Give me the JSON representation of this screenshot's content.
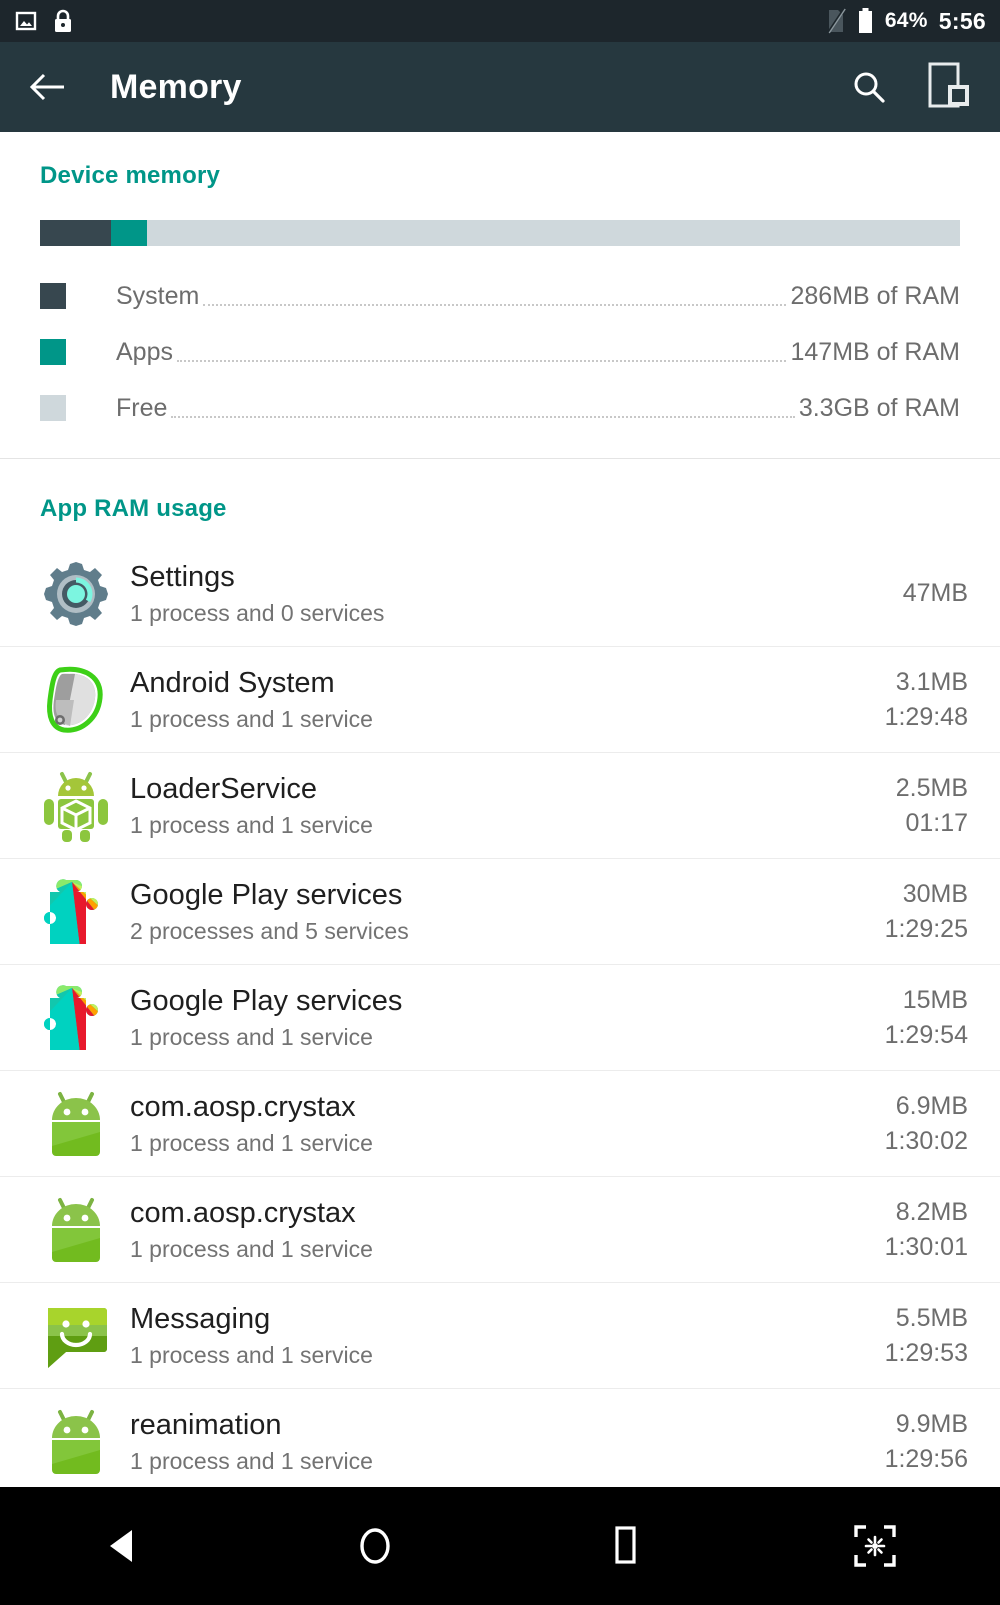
{
  "statusbar": {
    "left_icons": [
      "image-icon",
      "lock-icon"
    ],
    "right_icons": [
      "no-sim-icon",
      "battery-icon"
    ],
    "battery": "64%",
    "clock": "5:56"
  },
  "toolbar": {
    "back_icon": "arrow-back-icon",
    "title": "Memory",
    "search_icon": "search-icon",
    "device_icon": "device-chip-icon"
  },
  "device_memory": {
    "heading": "Device memory",
    "bar": [
      {
        "name": "System",
        "percent": 7.7,
        "color": "#37474f"
      },
      {
        "name": "Apps",
        "percent": 3.9,
        "color": "#009688"
      },
      {
        "name": "Free",
        "percent": 88.4,
        "color": "#cfd8dc"
      }
    ],
    "legend": [
      {
        "label": "System",
        "value": "286MB of RAM",
        "color": "#37474f"
      },
      {
        "label": "Apps",
        "value": "147MB of RAM",
        "color": "#009688"
      },
      {
        "label": "Free",
        "value": "3.3GB of RAM",
        "color": "#cfd8dc"
      }
    ]
  },
  "app_ram_usage": {
    "heading": "App RAM usage",
    "rows": [
      {
        "icon": "settings-gear-icon",
        "name": "Settings",
        "sub": "1 process and 0 services",
        "mem": "47MB",
        "time": ""
      },
      {
        "icon": "android-system-icon",
        "name": "Android System",
        "sub": "1 process and 1 service",
        "mem": "3.1MB",
        "time": "1:29:48"
      },
      {
        "icon": "android-box-robot-icon",
        "name": "LoaderService",
        "sub": "1 process and 1 service",
        "mem": "2.5MB",
        "time": "01:17"
      },
      {
        "icon": "google-play-services-icon",
        "name": "Google Play services",
        "sub": "2 processes and 5 services",
        "mem": "30MB",
        "time": "1:29:25"
      },
      {
        "icon": "google-play-services-icon",
        "name": "Google Play services",
        "sub": "1 process and 1 service",
        "mem": "15MB",
        "time": "1:29:54"
      },
      {
        "icon": "android-default-icon",
        "name": "com.aosp.crystax",
        "sub": "1 process and 1 service",
        "mem": "6.9MB",
        "time": "1:30:02"
      },
      {
        "icon": "android-default-icon",
        "name": "com.aosp.crystax",
        "sub": "1 process and 1 service",
        "mem": "8.2MB",
        "time": "1:30:01"
      },
      {
        "icon": "messaging-icon",
        "name": "Messaging",
        "sub": "1 process and 1 service",
        "mem": "5.5MB",
        "time": "1:29:53"
      },
      {
        "icon": "android-default-icon",
        "name": "reanimation",
        "sub": "1 process and 1 service",
        "mem": "9.9MB",
        "time": "1:29:56"
      }
    ]
  },
  "navbar": {
    "back": "nav-back-icon",
    "home": "nav-home-icon",
    "recents": "nav-recents-icon",
    "screenshot": "nav-screenshot-icon"
  },
  "colors": {
    "accent": "#009688",
    "toolbar": "#26383f",
    "statusbar": "#1d262c",
    "system": "#37474f",
    "free": "#cfd8dc"
  }
}
